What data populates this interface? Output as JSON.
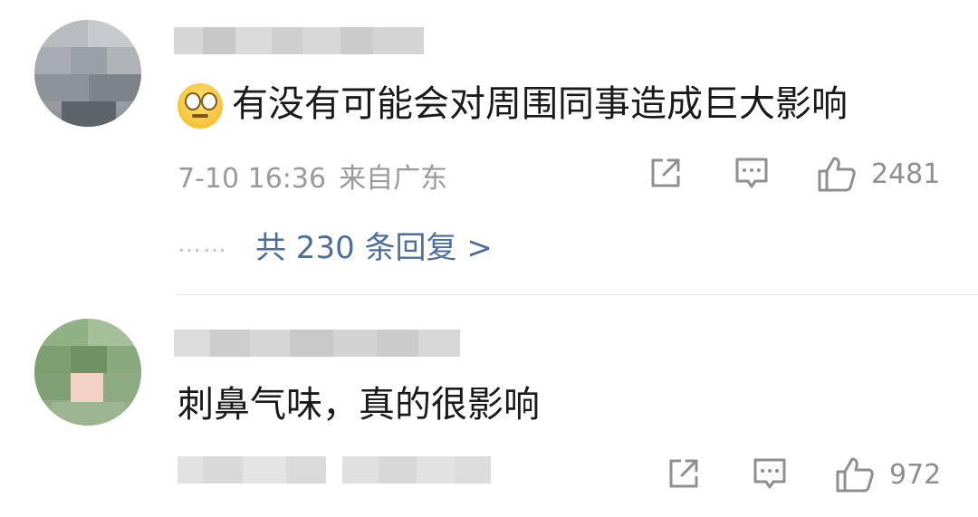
{
  "comments": [
    {
      "text": "有没有可能会对周围同事造成巨大影响",
      "date": "7-10 16:36",
      "location": "来自广东",
      "like_count": "2481",
      "replies_label": "共 230 条回复",
      "replies_arrow": ">",
      "replies_dots": "……"
    },
    {
      "text": "刺鼻气味，真的很影响",
      "like_count": "972"
    }
  ],
  "icons": {
    "share": "share-icon",
    "comment": "comment-icon",
    "like": "thumbs-up-icon",
    "emoji": "eye-roll-emoji"
  },
  "colors": {
    "text": "#1a1a1a",
    "meta": "#9a9a9a",
    "link": "#4d6e9b",
    "icon": "#8f8f8f"
  }
}
